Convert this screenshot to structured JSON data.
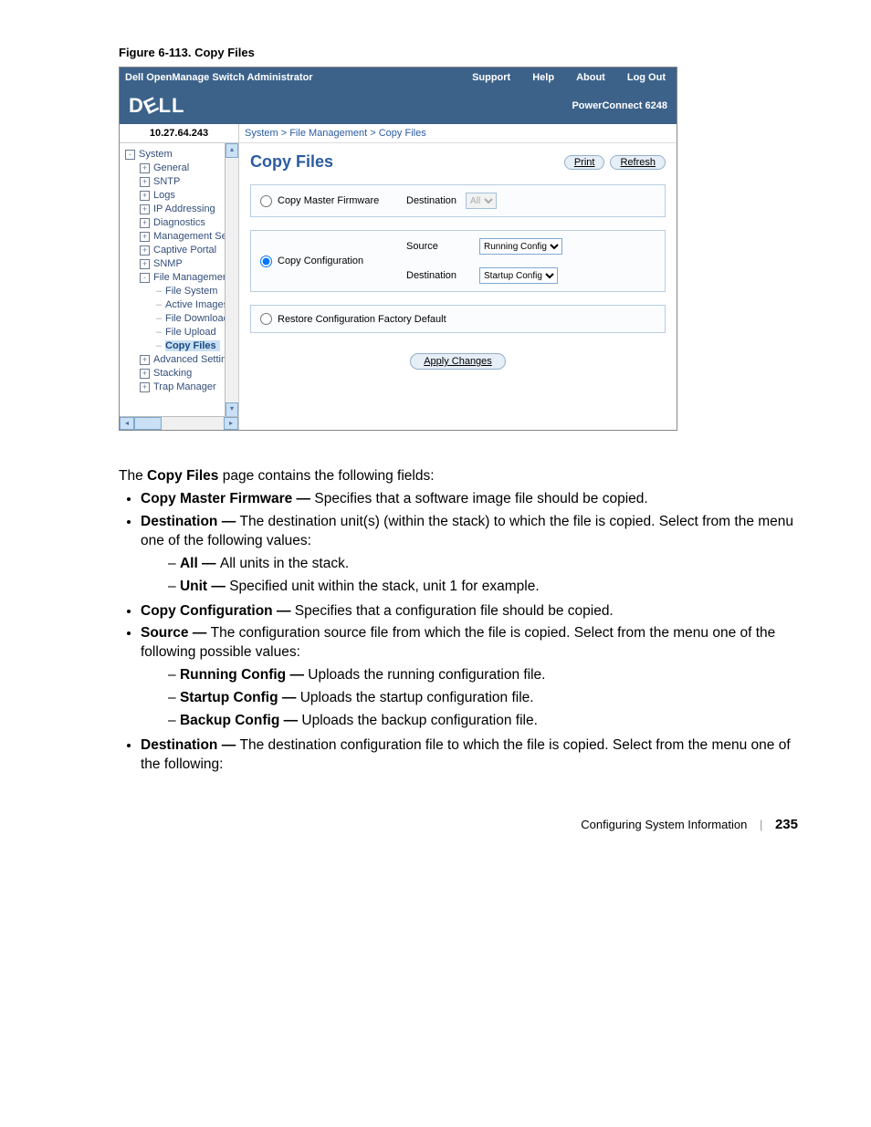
{
  "figure_caption": "Figure 6-113.    Copy Files",
  "topbar": {
    "title": "Dell OpenManage Switch Administrator",
    "links": [
      "Support",
      "Help",
      "About",
      "Log Out"
    ]
  },
  "brand": {
    "logo_text": "DELL",
    "product": "PowerConnect 6248"
  },
  "sidebar": {
    "ip": "10.27.64.243",
    "items": [
      {
        "level": 1,
        "marker": "-",
        "label": "System"
      },
      {
        "level": 2,
        "marker": "+",
        "label": "General"
      },
      {
        "level": 2,
        "marker": "+",
        "label": "SNTP"
      },
      {
        "level": 2,
        "marker": "+",
        "label": "Logs"
      },
      {
        "level": 2,
        "marker": "+",
        "label": "IP Addressing"
      },
      {
        "level": 2,
        "marker": "+",
        "label": "Diagnostics"
      },
      {
        "level": 2,
        "marker": "+",
        "label": "Management Secur"
      },
      {
        "level": 2,
        "marker": "+",
        "label": "Captive Portal"
      },
      {
        "level": 2,
        "marker": "+",
        "label": "SNMP"
      },
      {
        "level": 2,
        "marker": "-",
        "label": "File Management"
      },
      {
        "level": 3,
        "dash": true,
        "label": "File System"
      },
      {
        "level": 3,
        "dash": true,
        "label": "Active Images"
      },
      {
        "level": 3,
        "dash": true,
        "label": "File Download"
      },
      {
        "level": 3,
        "dash": true,
        "label": "File Upload"
      },
      {
        "level": 3,
        "dash": true,
        "label": "Copy Files",
        "selected": true
      },
      {
        "level": 2,
        "marker": "+",
        "label": "Advanced Settings"
      },
      {
        "level": 2,
        "marker": "+",
        "label": "Stacking"
      },
      {
        "level": 2,
        "marker": "+",
        "label": "Trap Manager"
      }
    ]
  },
  "content": {
    "breadcrumb": "System > File Management > Copy Files",
    "title": "Copy Files",
    "print": "Print",
    "refresh": "Refresh",
    "panel1": {
      "radio_label": "Copy Master Firmware",
      "dest_label": "Destination",
      "dest_value": "All"
    },
    "panel2": {
      "radio_label": "Copy Configuration",
      "source_label": "Source",
      "source_value": "Running Config",
      "dest_label": "Destination",
      "dest_value": "Startup Config"
    },
    "panel3": {
      "radio_label": "Restore Configuration Factory Default"
    },
    "apply": "Apply Changes"
  },
  "doc": {
    "intro_pre": "The ",
    "intro_bold": "Copy Files",
    "intro_post": " page contains the following fields:",
    "b1": {
      "t": "Copy Master Firmware — ",
      "d": "Specifies that a software image file should be copied."
    },
    "b2": {
      "t": "Destination — ",
      "d": "The destination unit(s) (within the stack) to which the file is copied. Select from the menu one of the following values:"
    },
    "b2a": {
      "t": "All — ",
      "d": "All units in the stack."
    },
    "b2b": {
      "t": "Unit — ",
      "d": "Specified unit within the stack, unit 1 for example."
    },
    "b3": {
      "t": "Copy Configuration — ",
      "d": "Specifies that a configuration file should be copied."
    },
    "b4": {
      "t": "Source — ",
      "d": "The configuration source file from which the file is copied. Select from the menu one of the following possible values:"
    },
    "b4a": {
      "t": "Running Config — ",
      "d": "Uploads the running configuration file."
    },
    "b4b": {
      "t": "Startup Config — ",
      "d": "Uploads the startup configuration file."
    },
    "b4c": {
      "t": "Backup Config — ",
      "d": "Uploads the backup configuration file."
    },
    "b5": {
      "t": "Destination — ",
      "d": "The destination configuration file to which the file is copied. Select from the menu one of the following:"
    }
  },
  "footer": {
    "section": "Configuring System Information",
    "page": "235"
  }
}
